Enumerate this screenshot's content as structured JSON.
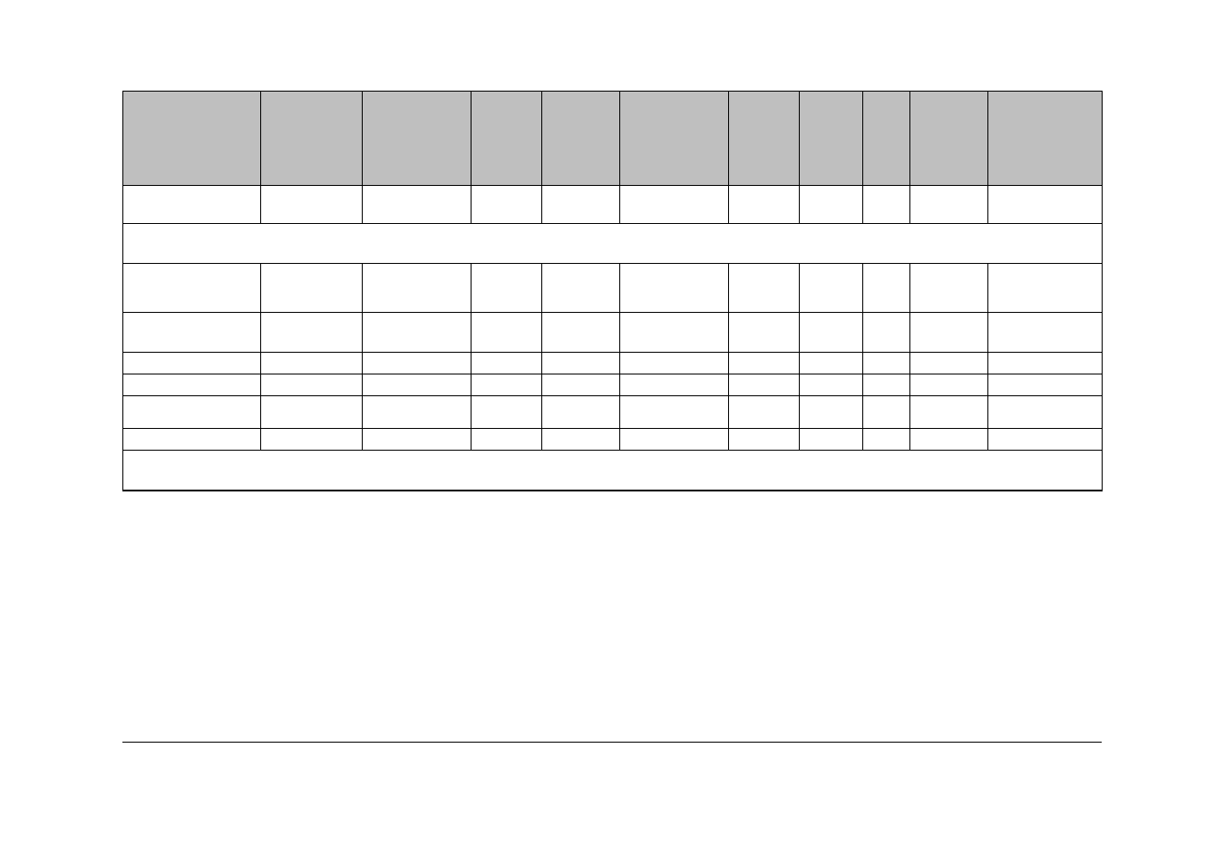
{
  "table": {
    "headers": [
      "",
      "",
      "",
      "",
      "",
      "",
      "",
      "",
      "",
      "",
      ""
    ],
    "rows": [
      {
        "type": "data",
        "cells": [
          "",
          "",
          "",
          "",
          "",
          "",
          "",
          "",
          "",
          "",
          ""
        ]
      },
      {
        "type": "merged",
        "cells": [
          ""
        ]
      },
      {
        "type": "data",
        "cells": [
          "",
          "",
          "",
          "",
          "",
          "",
          "",
          "",
          "",
          "",
          ""
        ]
      },
      {
        "type": "data",
        "cells": [
          "",
          "",
          "",
          "",
          "",
          "",
          "",
          "",
          "",
          "",
          ""
        ]
      },
      {
        "type": "data",
        "cells": [
          "",
          "",
          "",
          "",
          "",
          "",
          "",
          "",
          "",
          "",
          ""
        ]
      },
      {
        "type": "data",
        "cells": [
          "",
          "",
          "",
          "",
          "",
          "",
          "",
          "",
          "",
          "",
          ""
        ]
      },
      {
        "type": "data",
        "cells": [
          "",
          "",
          "",
          "",
          "",
          "",
          "",
          "",
          "",
          "",
          ""
        ]
      },
      {
        "type": "data",
        "cells": [
          "",
          "",
          "",
          "",
          "",
          "",
          "",
          "",
          "",
          "",
          ""
        ]
      },
      {
        "type": "merged",
        "cells": [
          ""
        ]
      }
    ]
  }
}
